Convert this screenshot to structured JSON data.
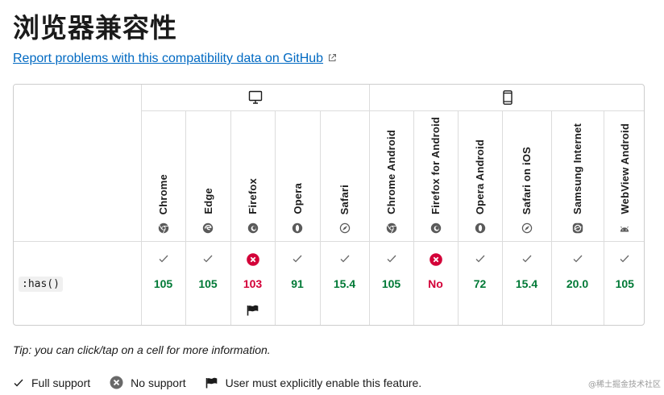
{
  "page": {
    "title": "浏览器兼容性",
    "report_link": "Report problems with this compatibility data on GitHub"
  },
  "table": {
    "platforms": [
      {
        "name": "desktop",
        "icon": "desktop-icon"
      },
      {
        "name": "mobile",
        "icon": "mobile-icon"
      }
    ],
    "browsers": [
      {
        "name": "Chrome",
        "icon": "chrome-icon",
        "platform": "desktop"
      },
      {
        "name": "Edge",
        "icon": "edge-icon",
        "platform": "desktop"
      },
      {
        "name": "Firefox",
        "icon": "firefox-icon",
        "platform": "desktop"
      },
      {
        "name": "Opera",
        "icon": "opera-icon",
        "platform": "desktop"
      },
      {
        "name": "Safari",
        "icon": "safari-icon",
        "platform": "desktop"
      },
      {
        "name": "Chrome Android",
        "icon": "chrome-icon",
        "platform": "mobile"
      },
      {
        "name": "Firefox for Android",
        "icon": "firefox-icon",
        "platform": "mobile"
      },
      {
        "name": "Opera Android",
        "icon": "opera-icon",
        "platform": "mobile"
      },
      {
        "name": "Safari on iOS",
        "icon": "safari-icon",
        "platform": "mobile"
      },
      {
        "name": "Samsung Internet",
        "icon": "samsung-internet-icon",
        "platform": "mobile"
      },
      {
        "name": "WebView Android",
        "icon": "android-icon",
        "platform": "mobile"
      }
    ],
    "feature": ":has()",
    "support": [
      {
        "status": "full",
        "version": "105"
      },
      {
        "status": "full",
        "version": "105"
      },
      {
        "status": "none",
        "version": "103",
        "flag": true
      },
      {
        "status": "full",
        "version": "91"
      },
      {
        "status": "full",
        "version": "15.4"
      },
      {
        "status": "full",
        "version": "105"
      },
      {
        "status": "none",
        "version": "No"
      },
      {
        "status": "full",
        "version": "72"
      },
      {
        "status": "full",
        "version": "15.4"
      },
      {
        "status": "full",
        "version": "20.0"
      },
      {
        "status": "full",
        "version": "105"
      }
    ]
  },
  "tip": "Tip: you can click/tap on a cell for more information.",
  "legend": {
    "full": "Full support",
    "none": "No support",
    "flag": "User must explicitly enable this feature."
  },
  "watermark": "@稀土掘金技术社区",
  "colors": {
    "yes": "#007936",
    "no": "#d30038",
    "link": "#0069c2",
    "border": "#cdcdcd"
  }
}
